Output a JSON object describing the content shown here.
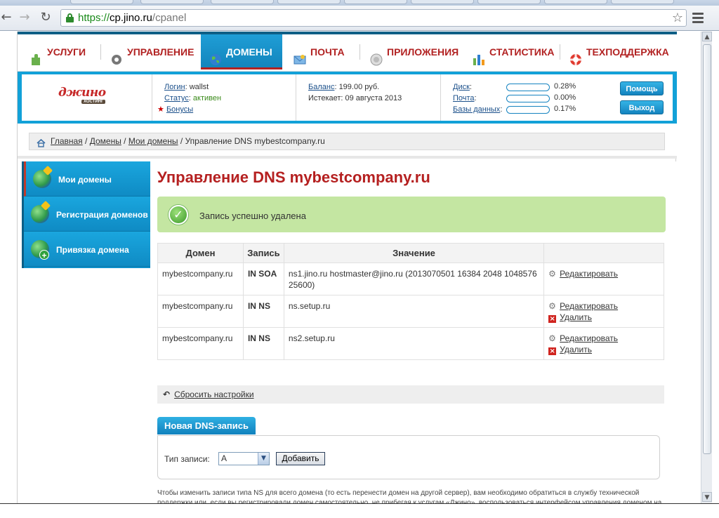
{
  "browser": {
    "url_scheme": "https://",
    "url_host": "cp.jino.ru",
    "url_path": "/cpanel"
  },
  "nav": {
    "items": [
      {
        "label": "Услуги",
        "icon": "puzzle-icon"
      },
      {
        "label": "Управление",
        "icon": "gear-icon"
      },
      {
        "label": "Домены",
        "icon": "globe-icon",
        "active": true
      },
      {
        "label": "Почта",
        "icon": "envelope-icon"
      },
      {
        "label": "Приложения",
        "icon": "apps-icon"
      },
      {
        "label": "Статистика",
        "icon": "bar-chart-icon"
      },
      {
        "label": "Техподдержка",
        "icon": "lifebuoy-icon"
      }
    ]
  },
  "account": {
    "logo_word": "джино",
    "logo_sub": "ХОСТИНГ",
    "login_label": "Логин",
    "login_value": ": wallst",
    "status_label": "Статус",
    "status_sep": ": ",
    "status_value": "активен",
    "bonus_label": "Бонусы",
    "balance_label": "Баланс",
    "balance_value": ": 199.00 руб.",
    "expires_text": "Истекает: 09 августа 2013",
    "disk_label": "Диск",
    "disk_pct": "0.28%",
    "mail_label": "Почта",
    "mail_pct": "0.00%",
    "db_label": "Базы данных",
    "db_pct": "0.17%",
    "colon": ":",
    "help_button": "Помощь",
    "logout_button": "Выход"
  },
  "breadcrumb": {
    "home": "Главная",
    "domains": "Домены",
    "my_domains": "Мои домены",
    "sep": " / ",
    "current": "Управление DNS mybestcompany.ru"
  },
  "sidebar": {
    "items": [
      {
        "label": "Мои домены"
      },
      {
        "label": "Регистрация доменов"
      },
      {
        "label": "Привязка домена"
      }
    ]
  },
  "main": {
    "title": "Управление DNS mybestcompany.ru",
    "success_message": "Запись успешно удалена",
    "table": {
      "headers": [
        "Домен",
        "Запись",
        "Значение",
        ""
      ],
      "rows": [
        {
          "domain": "mybestcompany.ru",
          "type": "IN SOA",
          "value": "ns1.jino.ru hostmaster@jino.ru (2013070501 16384 2048 1048576 25600)",
          "edit": "Редактировать"
        },
        {
          "domain": "mybestcompany.ru",
          "type": "IN NS",
          "value": "ns.setup.ru",
          "edit": "Редактировать",
          "delete": "Удалить"
        },
        {
          "domain": "mybestcompany.ru",
          "type": "IN NS",
          "value": "ns2.setup.ru",
          "edit": "Редактировать",
          "delete": "Удалить"
        }
      ]
    },
    "reset_link": "Сбросить настройки",
    "new_record_tab": "Новая DNS-запись",
    "record_type_label": "Тип записи:",
    "record_type_value": "A",
    "add_button": "Добавить",
    "note": "Чтобы изменить записи типа NS для всего домена (то есть перенести домен на другой сервер), вам необходимо обратиться в службу технической поддержки или, если вы регистрировали домен самостоятельно, не прибегая к услугам «Джино», воспользоваться интерфейсом управления доменом на сайте регистратора."
  }
}
